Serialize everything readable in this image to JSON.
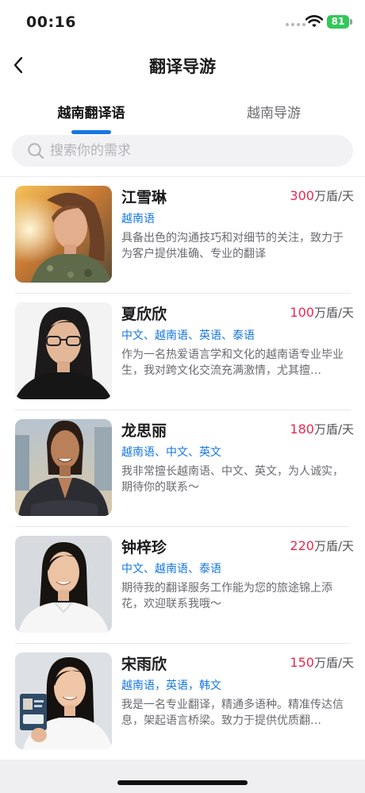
{
  "status_bar": {
    "time": "00:16",
    "battery": "81"
  },
  "header": {
    "title": "翻译导游"
  },
  "tabs": [
    {
      "label": "越南翻译语",
      "active": true
    },
    {
      "label": "越南导游",
      "active": false
    }
  ],
  "search": {
    "placeholder": "搜索你的需求",
    "value": ""
  },
  "colors": {
    "accent": "#1677e0",
    "price": "#e8294f",
    "battery": "#33c759"
  },
  "translators": [
    {
      "name": "江雪琳",
      "price": "300",
      "unit": "万盾/天",
      "languages": "越南语",
      "description": "具备出色的沟通技巧和对细节的关注，致力于为客户提供准确、专业的翻译"
    },
    {
      "name": "夏欣欣",
      "price": "100",
      "unit": "万盾/天",
      "languages": "中文、越南语、英语、泰语",
      "description": "作为一名热爱语言学和文化的越南语专业毕业生，我对跨文化交流充满激情，尤其擅…"
    },
    {
      "name": "龙思丽",
      "price": "180",
      "unit": "万盾/天",
      "languages": "越南语、中文、英文",
      "description": "我非常擅长越南语、中文、英文，为人诚实，期待你的联系～"
    },
    {
      "name": "钟梓珍",
      "price": "220",
      "unit": "万盾/天",
      "languages": "中文、越南语、泰语",
      "description": "期待我的翻译服务工作能为您的旅途锦上添花，欢迎联系我哦～"
    },
    {
      "name": "宋雨欣",
      "price": "150",
      "unit": "万盾/天",
      "languages": "越南语，英语，韩文",
      "description": "我是一名专业翻译，精通多语种。精准传达信息，架起语言桥梁。致力于提供优质翻…"
    }
  ]
}
